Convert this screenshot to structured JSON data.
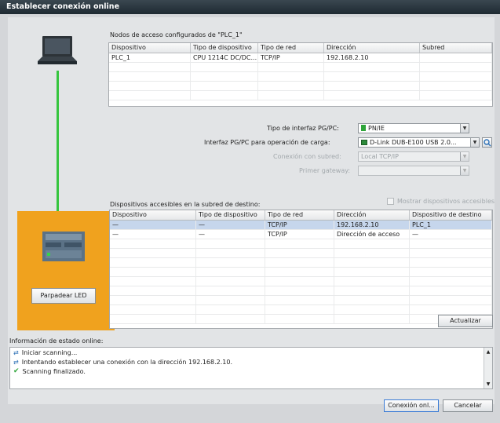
{
  "window": {
    "title": "Establecer conexión online"
  },
  "configured": {
    "caption": "Nodos de acceso configurados de \"PLC_1\"",
    "columns": [
      "Dispositivo",
      "Tipo de dispositivo",
      "Tipo de red",
      "Dirección",
      "Subred"
    ],
    "rows": [
      [
        "PLC_1",
        "CPU 1214C DC/DC...",
        "TCP/IP",
        "192.168.2.10",
        ""
      ]
    ]
  },
  "interface": {
    "type_label": "Tipo de interfaz PG/PC:",
    "type_value": "PN/IE",
    "pgpc_label": "Interfaz PG/PC para operación de carga:",
    "pgpc_value": "D-Link DUB-E100 USB 2.0...",
    "subnet_label": "Conexión con subred:",
    "subnet_value": "Local TCP/IP",
    "gateway_label": "Primer gateway:",
    "gateway_value": ""
  },
  "accessible": {
    "caption": "Dispositivos accesibles en la subred de destino:",
    "show_all_label": "Mostrar dispositivos accesibles",
    "columns": [
      "Dispositivo",
      "Tipo de dispositivo",
      "Tipo de red",
      "Dirección",
      "Dispositivo de destino"
    ],
    "rows": [
      [
        "—",
        "—",
        "TCP/IP",
        "192.168.2.10",
        "PLC_1"
      ],
      [
        "—",
        "—",
        "TCP/IP",
        "Dirección de acceso",
        "—"
      ]
    ]
  },
  "led_button": "Parpadear LED",
  "update_button": "Actualizar",
  "status": {
    "caption": "Información de estado online:",
    "lines": [
      "Iniciar scanning...",
      "Intentando establecer una conexión con la dirección 192.168.2.10.",
      "Scanning finalizado."
    ]
  },
  "footer": {
    "connect": "Conexión onl...",
    "cancel": "Cancelar"
  },
  "colors": {
    "accent_orange": "#f0a21e",
    "link_green": "#35c53e",
    "selection": "#c6d6ec"
  }
}
